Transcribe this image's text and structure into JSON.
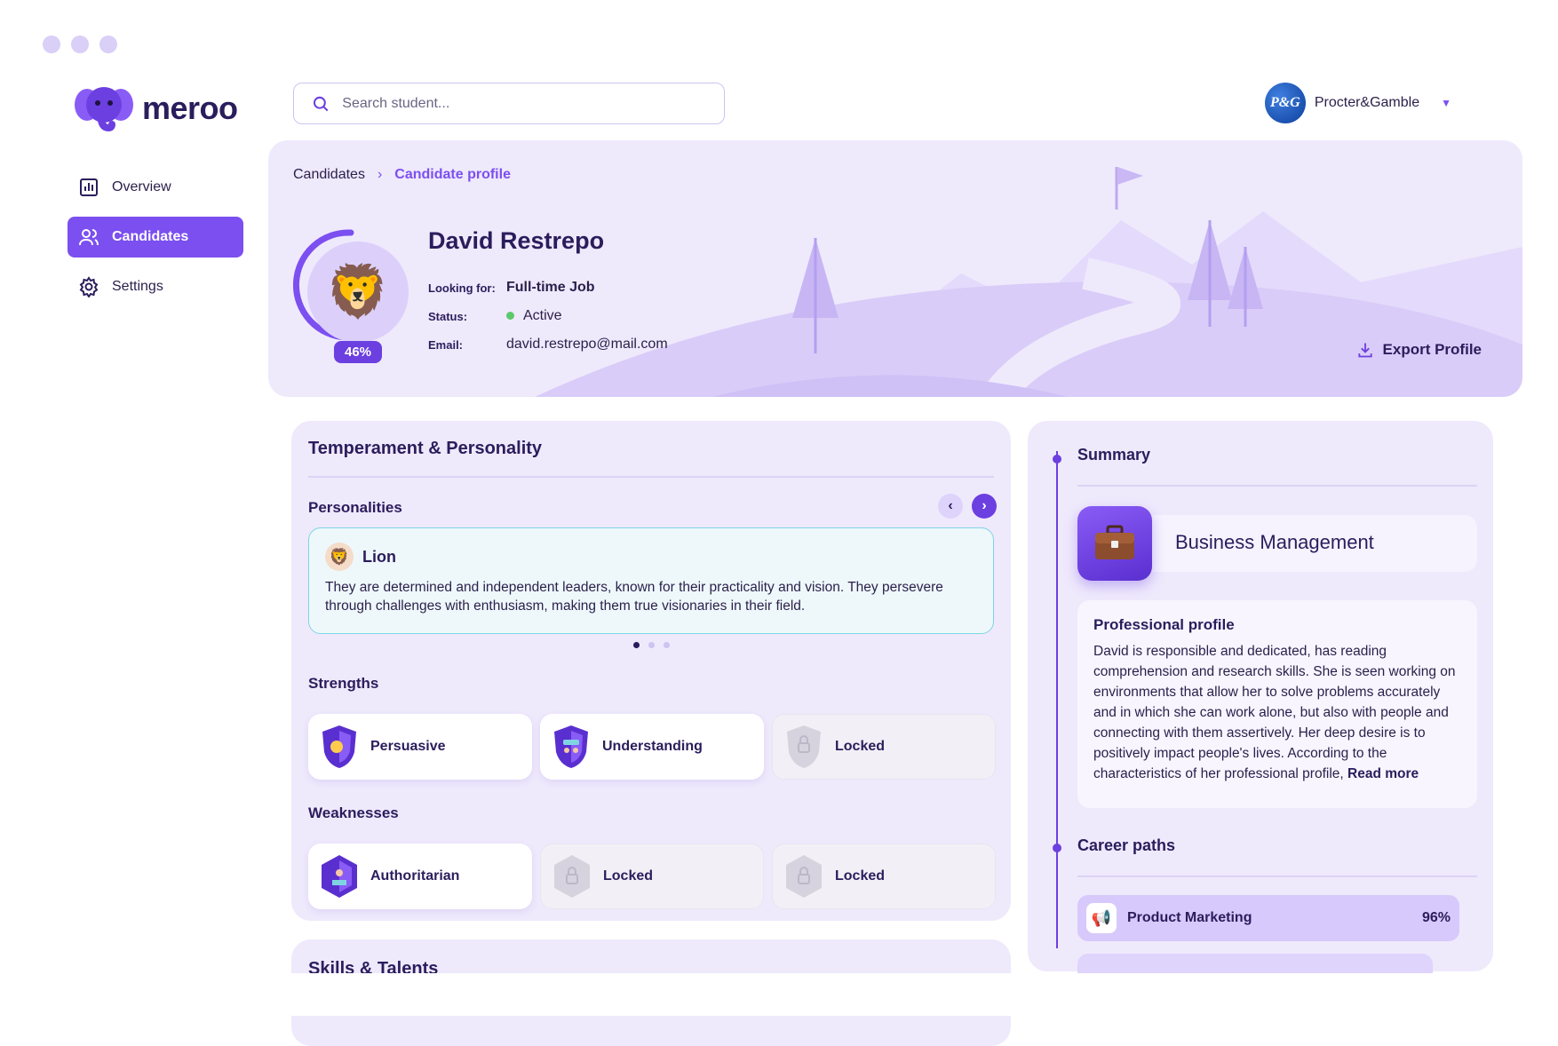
{
  "brand": {
    "name": "meroo"
  },
  "sidebar": {
    "items": [
      {
        "label": "Overview",
        "icon": "chart-icon"
      },
      {
        "label": "Candidates",
        "icon": "users-icon",
        "active": true
      },
      {
        "label": "Settings",
        "icon": "gear-icon"
      }
    ]
  },
  "search": {
    "placeholder": "Search student...",
    "value": ""
  },
  "company": {
    "logo_text": "P&G",
    "name": "Procter&Gamble"
  },
  "breadcrumb": {
    "parent": "Candidates",
    "current": "Candidate profile"
  },
  "profile": {
    "name": "David Restrepo",
    "progress": "46%",
    "progress_value": 0.46,
    "looking_for_label": "Looking for:",
    "looking_for": "Full-time Job",
    "status_label": "Status:",
    "status": "Active",
    "email_label": "Email:",
    "email": "david.restrepo@mail.com",
    "export_label": "Export Profile"
  },
  "temperament": {
    "title": "Temperament & Personality",
    "personalities_label": "Personalities",
    "personality": {
      "name": "Lion",
      "description": "They are determined and independent leaders, known for their practicality and vision. They persevere through challenges with enthusiasm, making them true visionaries in their field."
    },
    "strengths_label": "Strengths",
    "strengths": [
      "Persuasive",
      "Understanding",
      "Locked"
    ],
    "weaknesses_label": "Weaknesses",
    "weaknesses": [
      "Authoritarian",
      "Locked",
      "Locked"
    ]
  },
  "skills": {
    "title": "Skills & Talents"
  },
  "summary": {
    "title": "Summary",
    "area": "Business Management",
    "professional_title": "Professional profile",
    "professional_text": "David is responsible and dedicated, has reading comprehension and research skills. She is seen working on environments that allow her to solve problems accurately and in which she can work alone, but also with people and connecting with them assertively. Her deep desire is to positively impact people's lives. According to the characteristics of her professional profile,",
    "read_more": "Read more",
    "career_title": "Career paths",
    "careers": [
      {
        "name": "Product Marketing",
        "pct": "96%"
      }
    ]
  },
  "colors": {
    "accent": "#7b4ff0",
    "panel": "#efe9fc",
    "status_active": "#5cc96b"
  }
}
